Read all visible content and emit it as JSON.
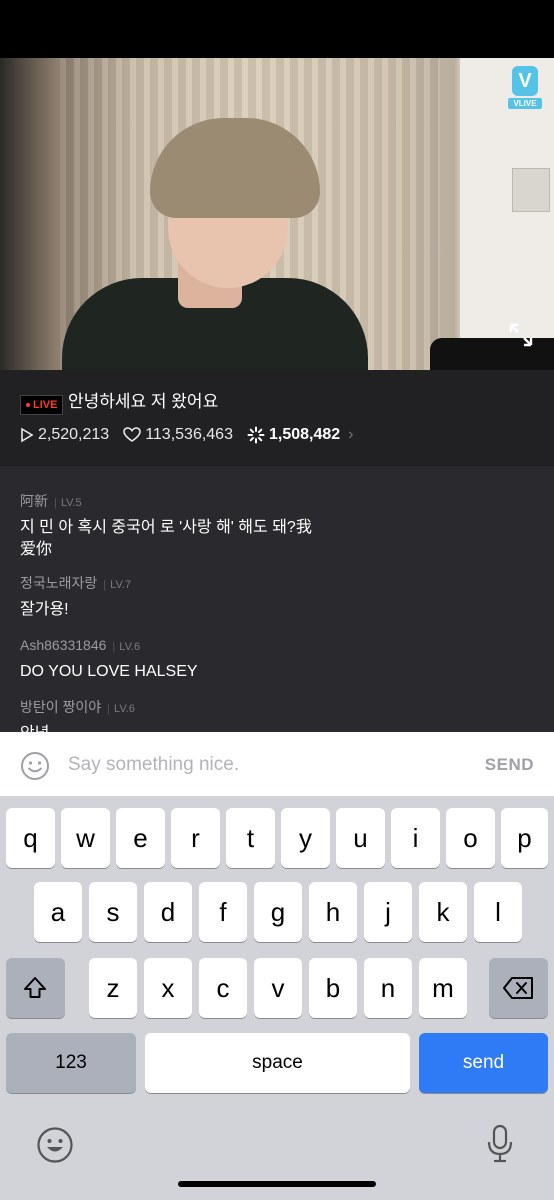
{
  "video": {
    "brand_logo": "V",
    "brand_name": "VLIVE"
  },
  "broadcast": {
    "live_label": "LIVE",
    "title": "안녕하세요 저 왔어요",
    "views": "2,520,213",
    "likes": "113,536,463",
    "stars": "1,508,482"
  },
  "chat": {
    "messages": [
      {
        "user": "阿新",
        "level": "LV.5",
        "text": "지 민 아 혹시 중국어 로 '사랑 해' 해도 돼?我爱你"
      },
      {
        "user": "정국노래자랑",
        "level": "LV.7",
        "text": "잘가용!"
      },
      {
        "user": "Ash86331846",
        "level": "LV.6",
        "text": "DO YOU LOVE HALSEY"
      },
      {
        "user": "방탄이 짱이야",
        "level": "LV.6",
        "text": "안녕"
      }
    ]
  },
  "input": {
    "placeholder": "Say something nice.",
    "send_label": "SEND"
  },
  "keyboard": {
    "row1": [
      "q",
      "w",
      "e",
      "r",
      "t",
      "y",
      "u",
      "i",
      "o",
      "p"
    ],
    "row2": [
      "a",
      "s",
      "d",
      "f",
      "g",
      "h",
      "j",
      "k",
      "l"
    ],
    "row3": [
      "z",
      "x",
      "c",
      "v",
      "b",
      "n",
      "m"
    ],
    "numbers_label": "123",
    "space_label": "space",
    "send_label": "send"
  },
  "colors": {
    "live_red": "#ff3b30",
    "send_blue": "#2f7bf6",
    "vlive_blue": "#55c3e8"
  }
}
